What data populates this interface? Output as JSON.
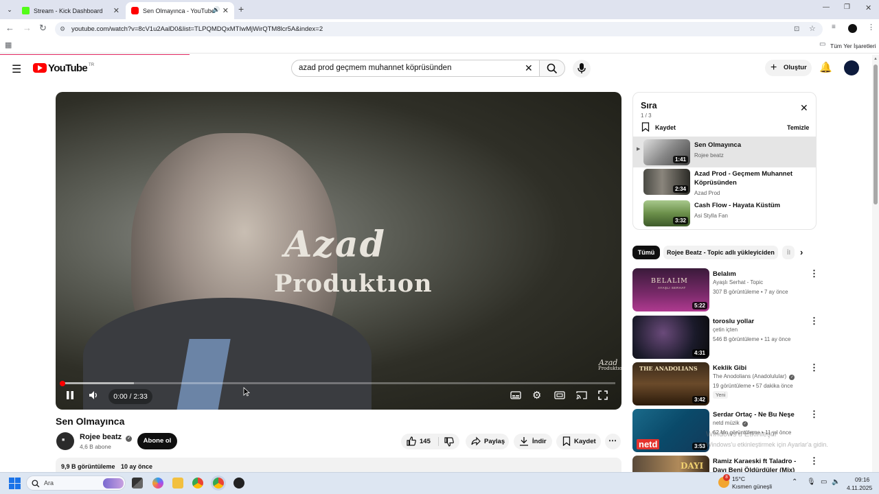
{
  "browser": {
    "tabs": [
      {
        "title": "Stream - Kick Dashboard",
        "close": "✕"
      },
      {
        "title": "Sen Olmayınca - YouTube",
        "close": "✕"
      }
    ],
    "new_tab": "+",
    "url": "youtube.com/watch?v=8cV1u2AalD0&list=TLPQMDQxMTIwMjWirQTM8lcr5A&index=2",
    "bookmarks_label": "Tüm Yer İşaretleri",
    "window_controls": {
      "minimize": "—",
      "restore": "❐",
      "close": "✕"
    },
    "nav": {
      "back": "←",
      "forward": "→",
      "reload": "↻"
    }
  },
  "youtube": {
    "logo": "YouTube",
    "region": "TR",
    "search_query": "azad prod geçmem muhannet köprüsünden",
    "create_label": "Oluştur"
  },
  "player": {
    "overlay_line1": "Azad",
    "overlay_line2": "Produktıon",
    "watermark_line1": "Azad",
    "watermark_line2": "Produktıon",
    "time": "0:00 / 2:33",
    "progress_fraction": 0.0,
    "buffered_fraction": 0.13
  },
  "video": {
    "title": "Sen Olmayınca",
    "channel": "Rojee beatz",
    "subscribers": "4,6 B abone",
    "subscribe_label": "Abone ol",
    "likes": "145",
    "share_label": "Paylaş",
    "download_label": "İndir",
    "save_label": "Kaydet",
    "views": "9,9 B görüntüleme",
    "uploaded": "10 ay önce"
  },
  "playlist": {
    "title": "Sıra",
    "position": "1 / 3",
    "save_label": "Kaydet",
    "clear_label": "Temizle",
    "items": [
      {
        "title": "Sen Olmayınca",
        "channel": "Rojee beatz",
        "duration": "1:41"
      },
      {
        "title": "Azad Prod - Geçmem Muhannet Köprüsünden",
        "channel": "Azad Prod",
        "duration": "2:34"
      },
      {
        "title": "Cash Flow - Hayata Küstüm",
        "channel": "Asi Stylla Fan",
        "duration": "3:32"
      }
    ]
  },
  "chips": [
    "Tümü",
    "Rojee Beatz - Topic adlı yükleyiciden",
    "İl"
  ],
  "recommendations": [
    {
      "title": "Belalım",
      "channel": "Ayaşlı Serhat - Topic",
      "meta": "307 B görüntüleme • 7 ay önce",
      "duration": "5:22",
      "thumb_text": "BELALIM",
      "thumb_sub": "AYAŞLI SERHAT"
    },
    {
      "title": "toroslu yollar",
      "channel": "çetin içten",
      "meta": "546 B görüntüleme • 11 ay önce",
      "duration": "4:31"
    },
    {
      "title": "Keklik Gibi",
      "channel": "The Anodolians (Anadolulular)",
      "meta": "19 görüntüleme • 57 dakika önce",
      "duration": "3:42",
      "badge": "Yeni",
      "thumb_text": "THE ANADOLIANS"
    },
    {
      "title": "Serdar Ortaç - Ne Bu Neşe",
      "channel": "netd müzik",
      "meta": "62 Mn görüntüleme • 11 yıl önce",
      "duration": "3:53",
      "thumb_text": "netd"
    },
    {
      "title": "Ramiz Karaeski ft Taladro - Dayı Beni Öldürdüler (Mix)",
      "channel": "",
      "meta": "",
      "duration": "",
      "thumb_text": "DAYI"
    }
  ],
  "windows_watermark": {
    "line1": "Windows'u Etkinleştir",
    "line2": "Windows'u etkinleştirmek için Ayarlar'a gidin."
  },
  "taskbar": {
    "search_placeholder": "Ara",
    "weather_temp": "15°C",
    "weather_text": "Kısmen güneşli",
    "weather_badge": "8",
    "time": "09:16",
    "date": "4.11.2025"
  },
  "colors": {
    "accent_red": "#ff0000",
    "kick_green": "#53fc18",
    "youtube_red": "#ff0000"
  }
}
